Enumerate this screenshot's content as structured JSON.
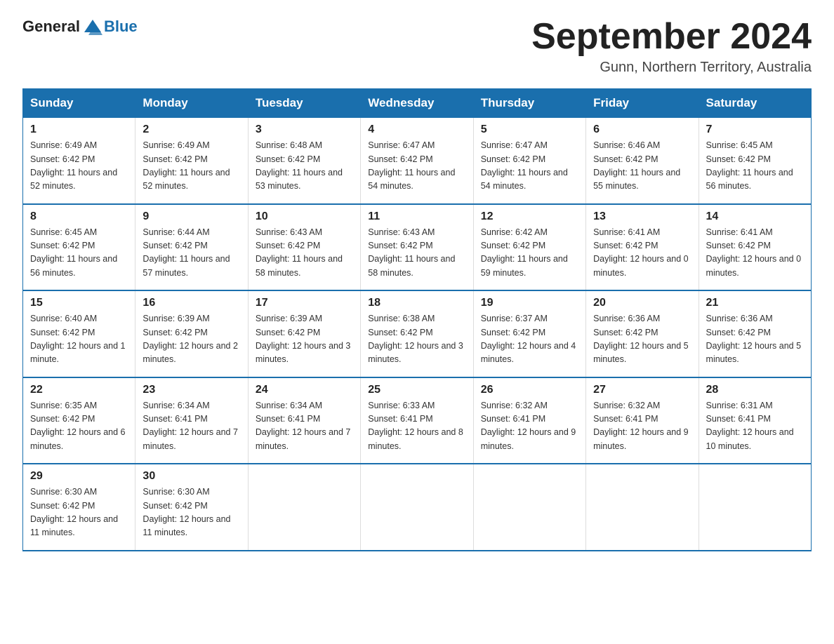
{
  "logo": {
    "text_general": "General",
    "text_blue": "Blue"
  },
  "title": "September 2024",
  "location": "Gunn, Northern Territory, Australia",
  "weekdays": [
    "Sunday",
    "Monday",
    "Tuesday",
    "Wednesday",
    "Thursday",
    "Friday",
    "Saturday"
  ],
  "weeks": [
    [
      {
        "day": "1",
        "sunrise": "6:49 AM",
        "sunset": "6:42 PM",
        "daylight": "11 hours and 52 minutes."
      },
      {
        "day": "2",
        "sunrise": "6:49 AM",
        "sunset": "6:42 PM",
        "daylight": "11 hours and 52 minutes."
      },
      {
        "day": "3",
        "sunrise": "6:48 AM",
        "sunset": "6:42 PM",
        "daylight": "11 hours and 53 minutes."
      },
      {
        "day": "4",
        "sunrise": "6:47 AM",
        "sunset": "6:42 PM",
        "daylight": "11 hours and 54 minutes."
      },
      {
        "day": "5",
        "sunrise": "6:47 AM",
        "sunset": "6:42 PM",
        "daylight": "11 hours and 54 minutes."
      },
      {
        "day": "6",
        "sunrise": "6:46 AM",
        "sunset": "6:42 PM",
        "daylight": "11 hours and 55 minutes."
      },
      {
        "day": "7",
        "sunrise": "6:45 AM",
        "sunset": "6:42 PM",
        "daylight": "11 hours and 56 minutes."
      }
    ],
    [
      {
        "day": "8",
        "sunrise": "6:45 AM",
        "sunset": "6:42 PM",
        "daylight": "11 hours and 56 minutes."
      },
      {
        "day": "9",
        "sunrise": "6:44 AM",
        "sunset": "6:42 PM",
        "daylight": "11 hours and 57 minutes."
      },
      {
        "day": "10",
        "sunrise": "6:43 AM",
        "sunset": "6:42 PM",
        "daylight": "11 hours and 58 minutes."
      },
      {
        "day": "11",
        "sunrise": "6:43 AM",
        "sunset": "6:42 PM",
        "daylight": "11 hours and 58 minutes."
      },
      {
        "day": "12",
        "sunrise": "6:42 AM",
        "sunset": "6:42 PM",
        "daylight": "11 hours and 59 minutes."
      },
      {
        "day": "13",
        "sunrise": "6:41 AM",
        "sunset": "6:42 PM",
        "daylight": "12 hours and 0 minutes."
      },
      {
        "day": "14",
        "sunrise": "6:41 AM",
        "sunset": "6:42 PM",
        "daylight": "12 hours and 0 minutes."
      }
    ],
    [
      {
        "day": "15",
        "sunrise": "6:40 AM",
        "sunset": "6:42 PM",
        "daylight": "12 hours and 1 minute."
      },
      {
        "day": "16",
        "sunrise": "6:39 AM",
        "sunset": "6:42 PM",
        "daylight": "12 hours and 2 minutes."
      },
      {
        "day": "17",
        "sunrise": "6:39 AM",
        "sunset": "6:42 PM",
        "daylight": "12 hours and 3 minutes."
      },
      {
        "day": "18",
        "sunrise": "6:38 AM",
        "sunset": "6:42 PM",
        "daylight": "12 hours and 3 minutes."
      },
      {
        "day": "19",
        "sunrise": "6:37 AM",
        "sunset": "6:42 PM",
        "daylight": "12 hours and 4 minutes."
      },
      {
        "day": "20",
        "sunrise": "6:36 AM",
        "sunset": "6:42 PM",
        "daylight": "12 hours and 5 minutes."
      },
      {
        "day": "21",
        "sunrise": "6:36 AM",
        "sunset": "6:42 PM",
        "daylight": "12 hours and 5 minutes."
      }
    ],
    [
      {
        "day": "22",
        "sunrise": "6:35 AM",
        "sunset": "6:42 PM",
        "daylight": "12 hours and 6 minutes."
      },
      {
        "day": "23",
        "sunrise": "6:34 AM",
        "sunset": "6:41 PM",
        "daylight": "12 hours and 7 minutes."
      },
      {
        "day": "24",
        "sunrise": "6:34 AM",
        "sunset": "6:41 PM",
        "daylight": "12 hours and 7 minutes."
      },
      {
        "day": "25",
        "sunrise": "6:33 AM",
        "sunset": "6:41 PM",
        "daylight": "12 hours and 8 minutes."
      },
      {
        "day": "26",
        "sunrise": "6:32 AM",
        "sunset": "6:41 PM",
        "daylight": "12 hours and 9 minutes."
      },
      {
        "day": "27",
        "sunrise": "6:32 AM",
        "sunset": "6:41 PM",
        "daylight": "12 hours and 9 minutes."
      },
      {
        "day": "28",
        "sunrise": "6:31 AM",
        "sunset": "6:41 PM",
        "daylight": "12 hours and 10 minutes."
      }
    ],
    [
      {
        "day": "29",
        "sunrise": "6:30 AM",
        "sunset": "6:42 PM",
        "daylight": "12 hours and 11 minutes."
      },
      {
        "day": "30",
        "sunrise": "6:30 AM",
        "sunset": "6:42 PM",
        "daylight": "12 hours and 11 minutes."
      },
      null,
      null,
      null,
      null,
      null
    ]
  ],
  "label_sunrise": "Sunrise:",
  "label_sunset": "Sunset:",
  "label_daylight": "Daylight:"
}
